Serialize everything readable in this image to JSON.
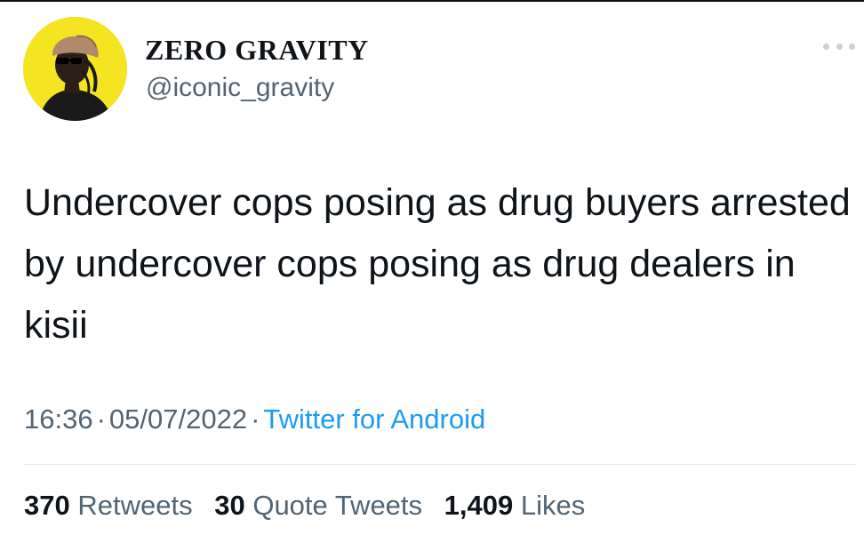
{
  "author": {
    "display_name": "ZERO GRAVITY",
    "handle": "@iconic_gravity",
    "avatar_icon": "profile-avatar-illustration",
    "avatar_bg": "#f5e421"
  },
  "tweet": {
    "text": "Undercover cops posing as drug buyers arrested by undercover cops posing as drug dealers in kisii",
    "time": "16:36",
    "date": "05/07/2022",
    "source": "Twitter for Android",
    "separator": "·"
  },
  "stats": {
    "retweets_count": "370",
    "retweets_label": "Retweets",
    "quotes_count": "30",
    "quotes_label": "Quote Tweets",
    "likes_count": "1,409",
    "likes_label": "Likes"
  },
  "colors": {
    "text_primary": "#0f1419",
    "text_secondary": "#536471",
    "link": "#1d9bf0",
    "divider": "#e3e6e8"
  },
  "icons": {
    "more": "more-dots-icon"
  }
}
